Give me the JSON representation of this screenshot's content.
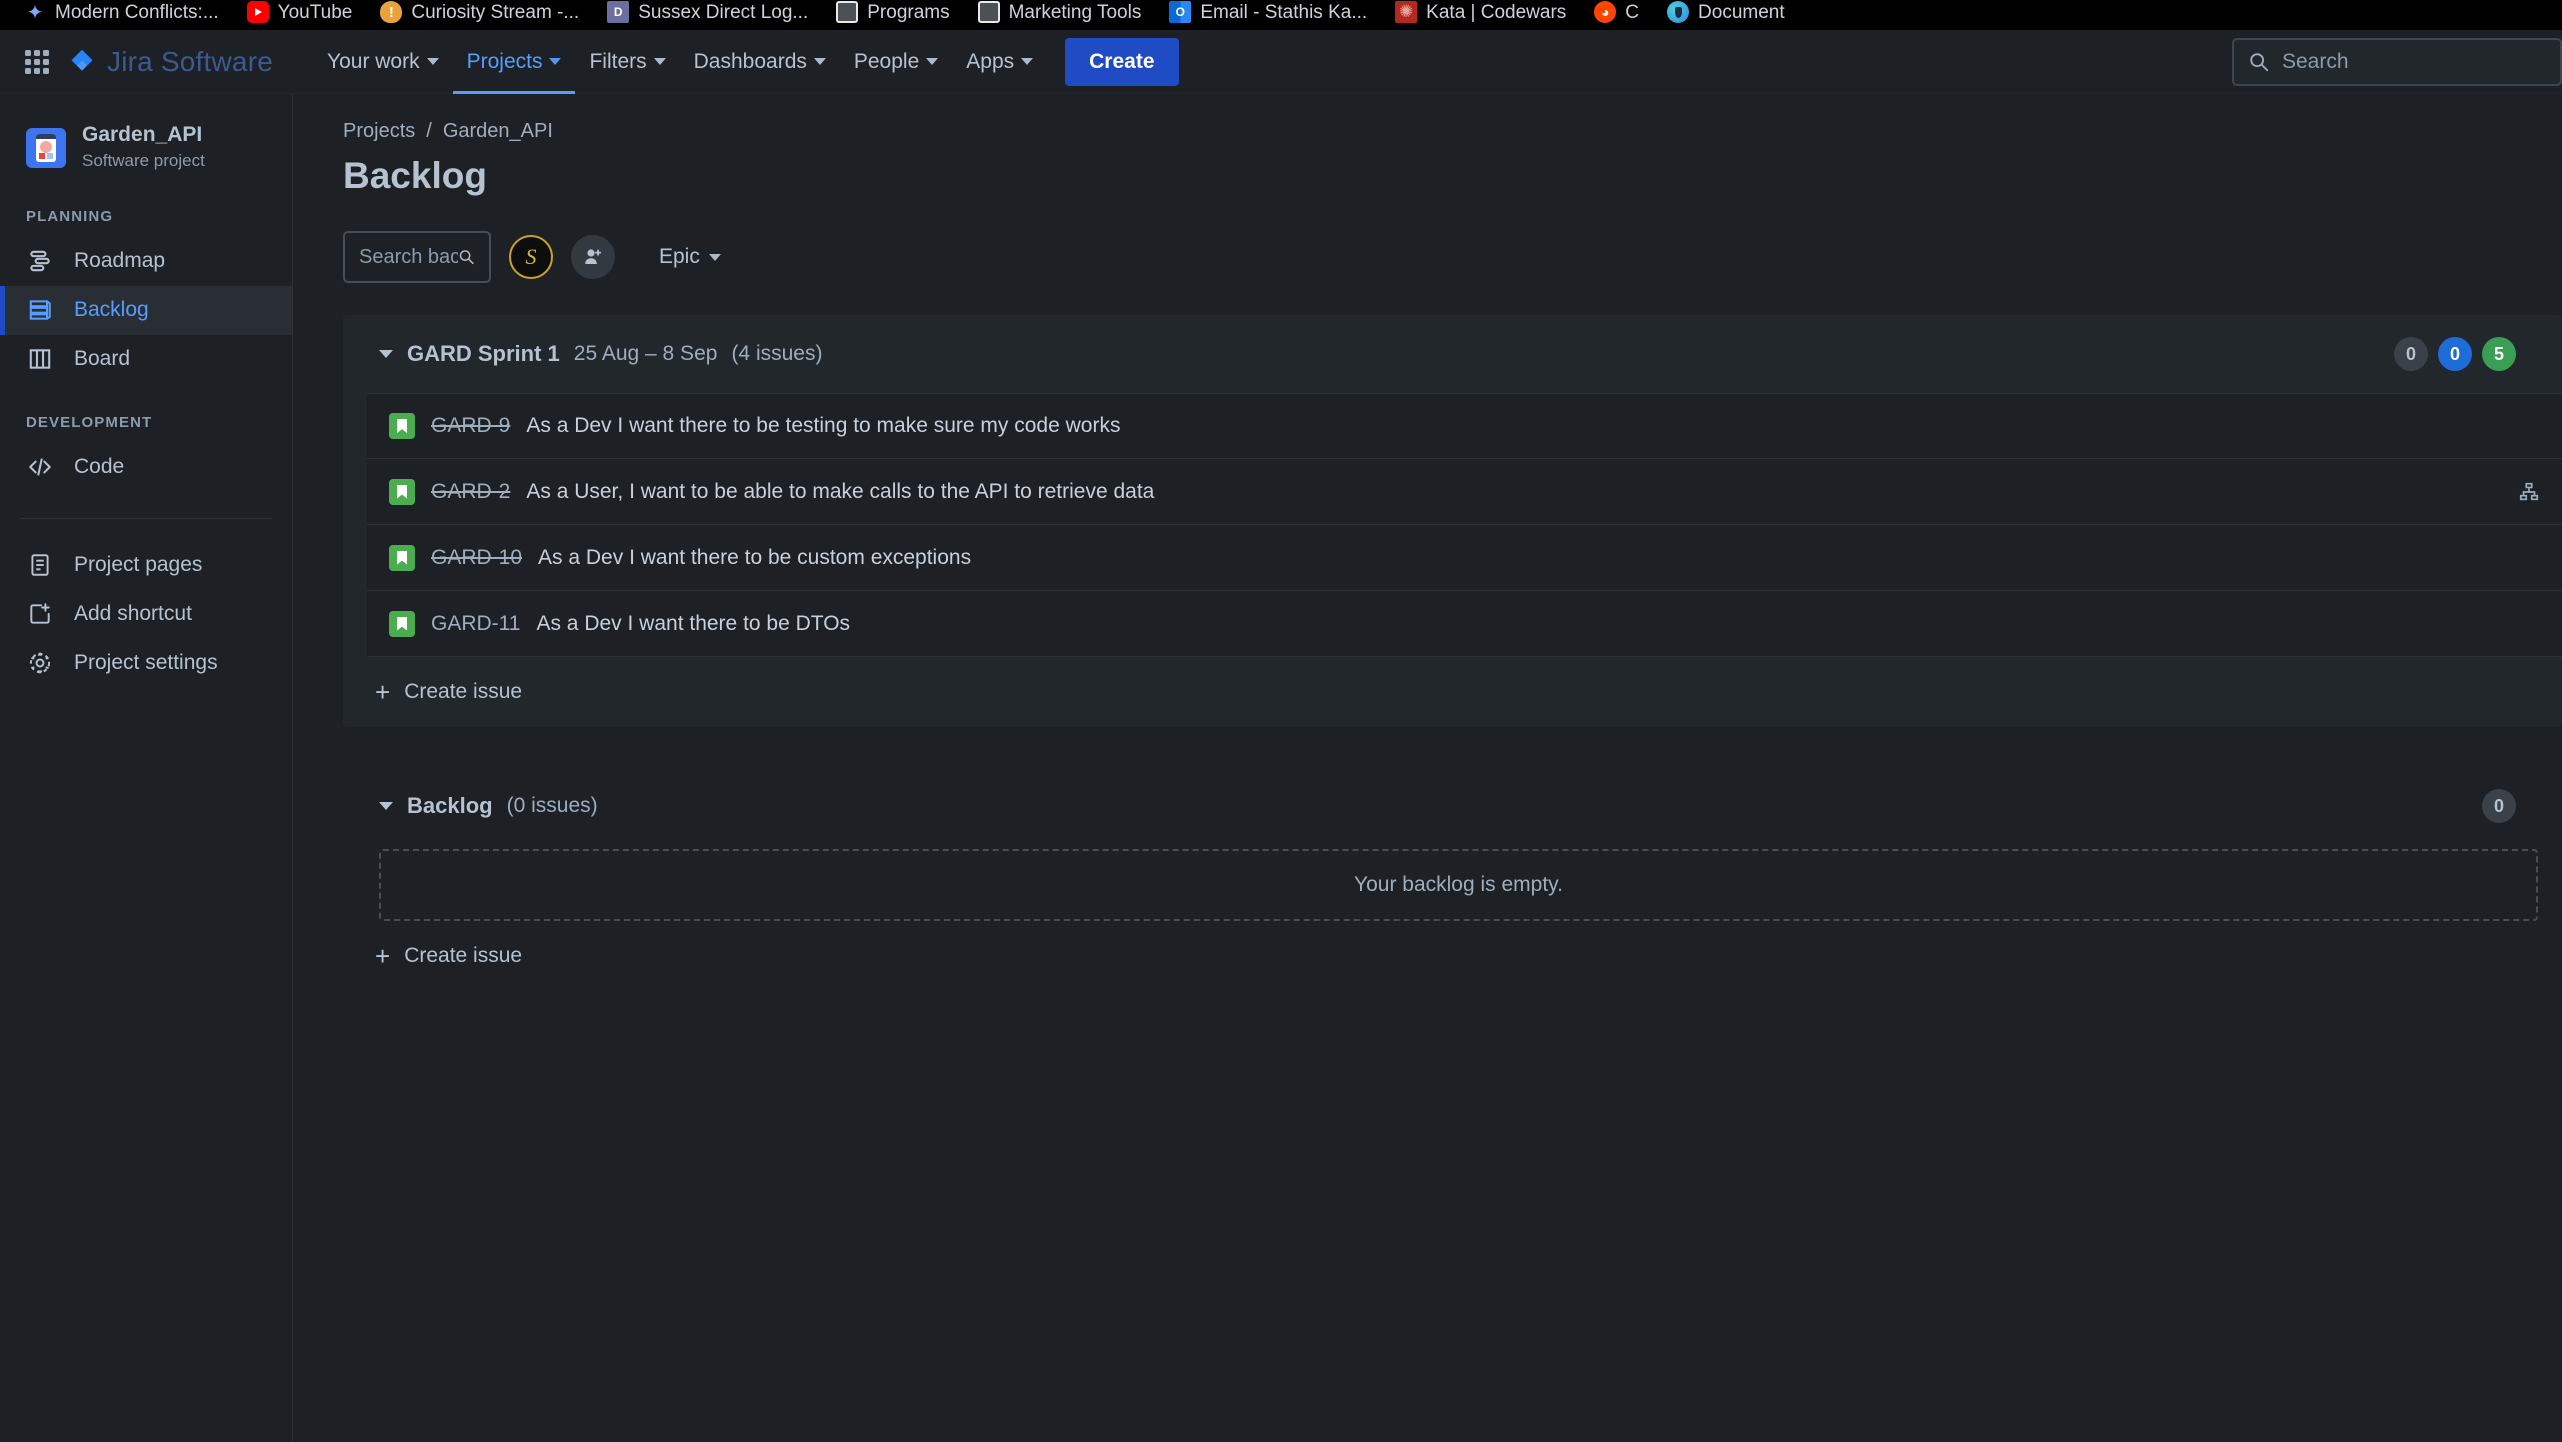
{
  "browser": {
    "bookmarks": [
      {
        "label": "Modern Conflicts:...",
        "icon": "spark-icon"
      },
      {
        "label": "YouTube",
        "icon": "youtube-icon"
      },
      {
        "label": "Curiosity Stream -...",
        "icon": "curiosity-stream-icon"
      },
      {
        "label": "Sussex Direct Log...",
        "icon": "sussex-direct-icon"
      },
      {
        "label": "Programs",
        "icon": "folder-icon"
      },
      {
        "label": "Marketing Tools",
        "icon": "folder-icon"
      },
      {
        "label": "Email - Stathis Ka...",
        "icon": "outlook-icon"
      },
      {
        "label": "Kata | Codewars",
        "icon": "codewars-icon"
      },
      {
        "label": "C",
        "icon": "reddit-icon"
      },
      {
        "label": "Document",
        "icon": "document-icon"
      }
    ]
  },
  "topnav": {
    "app_switcher": "app-switcher-icon",
    "brand": "Jira Software",
    "items": [
      {
        "label": "Your work",
        "active": false
      },
      {
        "label": "Projects",
        "active": true
      },
      {
        "label": "Filters",
        "active": false
      },
      {
        "label": "Dashboards",
        "active": false
      },
      {
        "label": "People",
        "active": false
      },
      {
        "label": "Apps",
        "active": false
      }
    ],
    "create_label": "Create",
    "search": {
      "placeholder": "Search",
      "value": ""
    },
    "accent": "#579dff",
    "create_bg": "#1f4cc4"
  },
  "sidebar": {
    "project": {
      "name": "Garden_API",
      "type": "Software project"
    },
    "sections": [
      {
        "title": "PLANNING",
        "items": [
          {
            "label": "Roadmap",
            "icon": "roadmap-icon",
            "active": false
          },
          {
            "label": "Backlog",
            "icon": "backlog-icon",
            "active": true
          },
          {
            "label": "Board",
            "icon": "board-icon",
            "active": false
          }
        ]
      },
      {
        "title": "DEVELOPMENT",
        "items": [
          {
            "label": "Code",
            "icon": "code-icon",
            "active": false
          }
        ]
      }
    ],
    "footer_items": [
      {
        "label": "Project pages",
        "icon": "page-icon"
      },
      {
        "label": "Add shortcut",
        "icon": "add-shortcut-icon"
      },
      {
        "label": "Project settings",
        "icon": "gear-icon"
      }
    ]
  },
  "main": {
    "breadcrumb": {
      "parent": "Projects",
      "separator": "/",
      "current": "Garden_API"
    },
    "title": "Backlog",
    "toolbar": {
      "search_placeholder": "Search back",
      "search_value": "",
      "avatar_initial": "S",
      "add_people_label": "add-people-icon",
      "epic_label": "Epic"
    },
    "sprint": {
      "name": "GARD Sprint 1",
      "dates": "25 Aug – 8 Sep",
      "issue_count": "(4 issues)",
      "badges": [
        {
          "value": "0",
          "color": "grey"
        },
        {
          "value": "0",
          "color": "blue"
        },
        {
          "value": "5",
          "color": "green"
        }
      ],
      "issues": [
        {
          "key": "GARD-9",
          "done": true,
          "summary": "As a Dev I want there to be testing to make sure my code works",
          "has_child_icon": false
        },
        {
          "key": "GARD-2",
          "done": true,
          "summary": "As a User, I want to be able to make calls to the API to retrieve data",
          "has_child_icon": true
        },
        {
          "key": "GARD-10",
          "done": true,
          "summary": "As a Dev I want there to be custom exceptions",
          "has_child_icon": false
        },
        {
          "key": "GARD-11",
          "done": false,
          "summary": "As a Dev I want there to be DTOs",
          "has_child_icon": false
        }
      ],
      "create_issue_label": "Create issue"
    },
    "backlog": {
      "name": "Backlog",
      "issue_count": "(0 issues)",
      "empty_text": "Your backlog is empty.",
      "create_issue_label": "Create issue",
      "badge": "0"
    }
  }
}
